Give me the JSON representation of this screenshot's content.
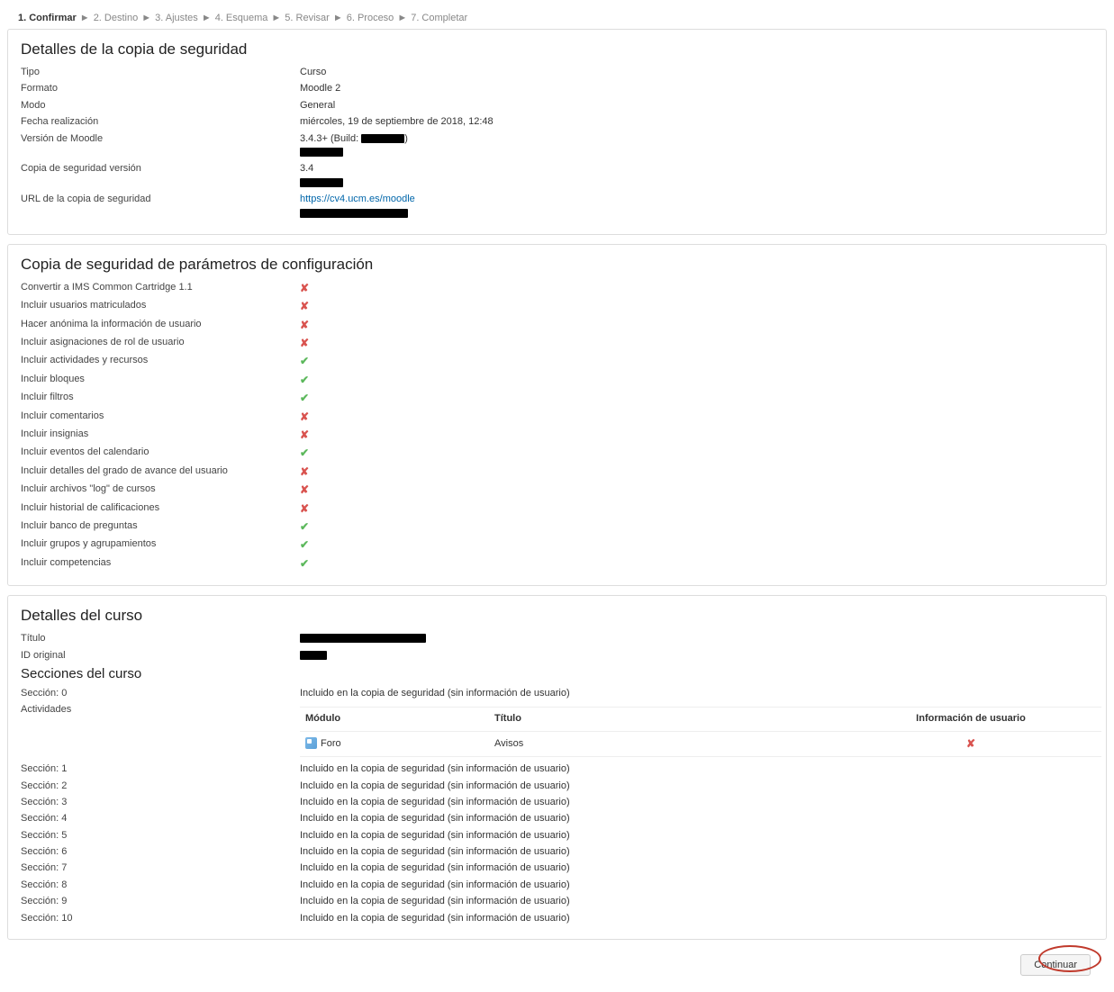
{
  "breadcrumb": [
    {
      "label": "1. Confirmar",
      "active": true
    },
    {
      "label": "2. Destino",
      "active": false
    },
    {
      "label": "3. Ajustes",
      "active": false
    },
    {
      "label": "4. Esquema",
      "active": false
    },
    {
      "label": "5. Revisar",
      "active": false
    },
    {
      "label": "6. Proceso",
      "active": false
    },
    {
      "label": "7. Completar",
      "active": false
    }
  ],
  "details": {
    "heading": "Detalles de la copia de seguridad",
    "rows": [
      {
        "k": "Tipo",
        "v": "Curso"
      },
      {
        "k": "Formato",
        "v": "Moodle 2"
      },
      {
        "k": "Modo",
        "v": "General"
      },
      {
        "k": "Fecha realización",
        "v": "miércoles, 19 de septiembre de 2018, 12:48"
      },
      {
        "k": "Versión de Moodle",
        "v": "3.4.3+ (Build: ████████)\n████████"
      },
      {
        "k": "Copia de seguridad versión",
        "v": "3.4\n████████"
      },
      {
        "k": "URL de la copia de seguridad",
        "v": "https://cv4.ucm.es/moodle\n████████████████████"
      }
    ]
  },
  "settings": {
    "heading": "Copia de seguridad de parámetros de configuración",
    "rows": [
      {
        "k": "Convertir a IMS Common Cartridge 1.1",
        "ok": false
      },
      {
        "k": "Incluir usuarios matriculados",
        "ok": false
      },
      {
        "k": "Hacer anónima la información de usuario",
        "ok": false
      },
      {
        "k": "Incluir asignaciones de rol de usuario",
        "ok": false
      },
      {
        "k": "Incluir actividades y recursos",
        "ok": true
      },
      {
        "k": "Incluir bloques",
        "ok": true
      },
      {
        "k": "Incluir filtros",
        "ok": true
      },
      {
        "k": "Incluir comentarios",
        "ok": false
      },
      {
        "k": "Incluir insignias",
        "ok": false
      },
      {
        "k": "Incluir eventos del calendario",
        "ok": true
      },
      {
        "k": "Incluir detalles del grado de avance del usuario",
        "ok": false
      },
      {
        "k": "Incluir archivos \"log\" de cursos",
        "ok": false
      },
      {
        "k": "Incluir historial de calificaciones",
        "ok": false
      },
      {
        "k": "Incluir banco de preguntas",
        "ok": true
      },
      {
        "k": "Incluir grupos y agrupamientos",
        "ok": true
      },
      {
        "k": "Incluir competencias",
        "ok": true
      }
    ]
  },
  "course": {
    "heading": "Detalles del curso",
    "title_label": "Título",
    "title_value": "████████████████████",
    "id_label": "ID original",
    "id_value": "████",
    "sections_heading": "Secciones del curso",
    "section0_label": "Sección: 0",
    "section0_value": "Incluido en la copia de seguridad (sin información de usuario)",
    "activities_label": "Actividades",
    "activities_header": {
      "module": "Módulo",
      "title": "Título",
      "userinfo": "Información de usuario"
    },
    "activities": [
      {
        "module": "Foro",
        "title": "Avisos",
        "userinfo_ok": false
      }
    ],
    "sections": [
      {
        "k": "Sección: 1",
        "v": "Incluido en la copia de seguridad (sin información de usuario)"
      },
      {
        "k": "Sección: 2",
        "v": "Incluido en la copia de seguridad (sin información de usuario)"
      },
      {
        "k": "Sección: 3",
        "v": "Incluido en la copia de seguridad (sin información de usuario)"
      },
      {
        "k": "Sección: 4",
        "v": "Incluido en la copia de seguridad (sin información de usuario)"
      },
      {
        "k": "Sección: 5",
        "v": "Incluido en la copia de seguridad (sin información de usuario)"
      },
      {
        "k": "Sección: 6",
        "v": "Incluido en la copia de seguridad (sin información de usuario)"
      },
      {
        "k": "Sección: 7",
        "v": "Incluido en la copia de seguridad (sin información de usuario)"
      },
      {
        "k": "Sección: 8",
        "v": "Incluido en la copia de seguridad (sin información de usuario)"
      },
      {
        "k": "Sección: 9",
        "v": "Incluido en la copia de seguridad (sin información de usuario)"
      },
      {
        "k": "Sección: 10",
        "v": "Incluido en la copia de seguridad (sin información de usuario)"
      }
    ]
  },
  "buttons": {
    "continue": "Continuar"
  }
}
